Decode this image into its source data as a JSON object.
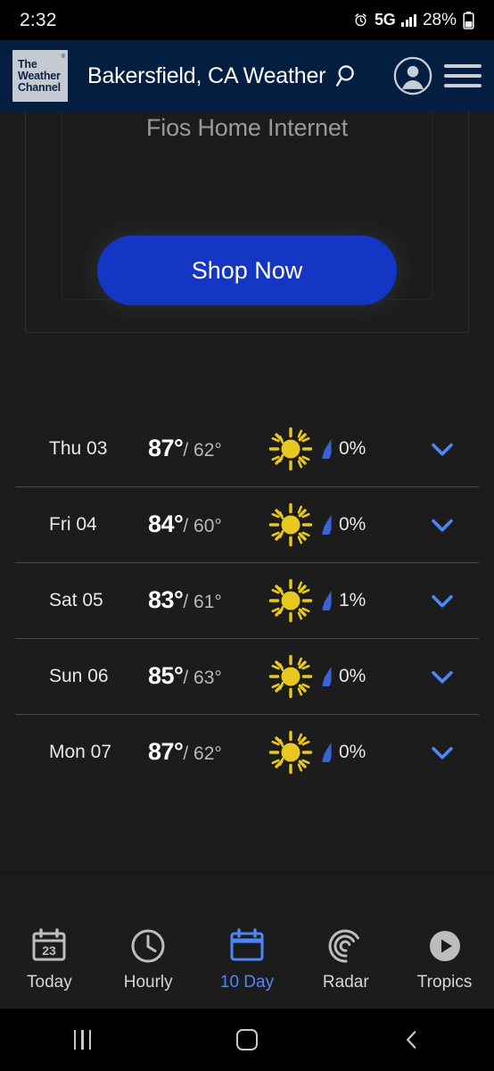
{
  "statusbar": {
    "time": "2:32",
    "alarm_icon": "alarm-clock-icon",
    "network": "5G",
    "signal_icon": "signal-bars-icon",
    "battery_percent": "28%",
    "battery_icon": "battery-icon"
  },
  "header": {
    "logo_line1": "The",
    "logo_line2": "Weather",
    "logo_line3": "Channel",
    "logo_registered": "®",
    "title": "Bakersfield, CA Weather",
    "search_icon": "search-icon",
    "account_icon": "account-avatar-icon",
    "menu_icon": "hamburger-menu-icon",
    "brand_color": "#041e42"
  },
  "ad": {
    "title": "Fios Home Internet",
    "cta_label": "Shop Now",
    "cta_color": "#1336c4"
  },
  "forecast": {
    "rows": [
      {
        "day": "Thu 03",
        "high": "87°",
        "low": "/ 62°",
        "condition_icon": "sunny-icon",
        "precip": "0%",
        "expand_icon": "chevron-down-icon"
      },
      {
        "day": "Fri 04",
        "high": "84°",
        "low": "/ 60°",
        "condition_icon": "sunny-icon",
        "precip": "0%",
        "expand_icon": "chevron-down-icon"
      },
      {
        "day": "Sat 05",
        "high": "83°",
        "low": "/ 61°",
        "condition_icon": "sunny-icon",
        "precip": "1%",
        "expand_icon": "chevron-down-icon"
      },
      {
        "day": "Sun 06",
        "high": "85°",
        "low": "/ 63°",
        "condition_icon": "sunny-icon",
        "precip": "0%",
        "expand_icon": "chevron-down-icon"
      },
      {
        "day": "Mon 07",
        "high": "87°",
        "low": "/ 62°",
        "condition_icon": "sunny-icon",
        "precip": "0%",
        "expand_icon": "chevron-down-icon"
      }
    ],
    "sun_color": "#e8c81e",
    "precip_color": "#3b63d8",
    "chevron_color": "#4d86f7"
  },
  "bottomnav": {
    "items": [
      {
        "label": "Today",
        "icon": "calendar-23-icon",
        "active": false
      },
      {
        "label": "Hourly",
        "icon": "clock-icon",
        "active": false
      },
      {
        "label": "10 Day",
        "icon": "calendar-icon",
        "active": true
      },
      {
        "label": "Radar",
        "icon": "radar-icon",
        "active": false
      },
      {
        "label": "Tropics",
        "icon": "play-circle-icon",
        "active": false
      }
    ],
    "calendar_day_number": "23",
    "active_color": "#4d86f7"
  },
  "androidnav": {
    "recents_icon": "recents-icon",
    "home_icon": "home-icon",
    "back_icon": "back-icon"
  }
}
